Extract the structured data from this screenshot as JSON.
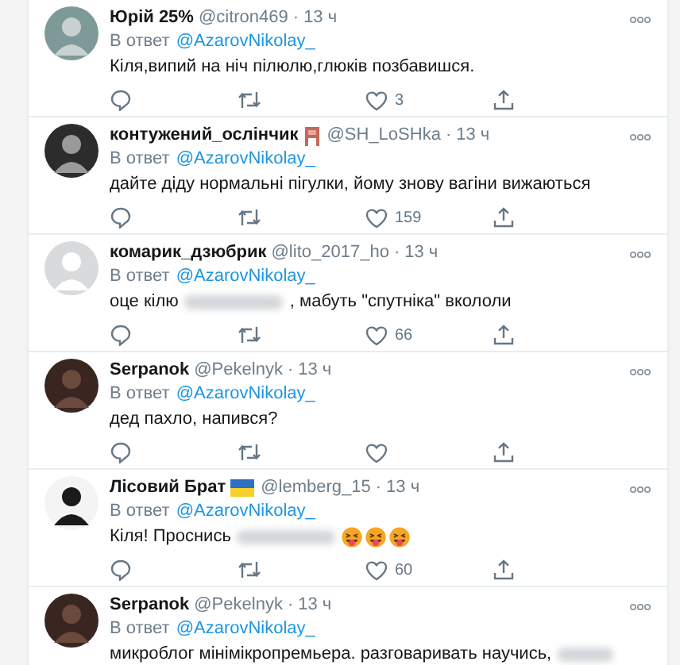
{
  "replies": [
    {
      "name": "Юрій 25%",
      "handle": "@citron469",
      "separator": "·",
      "time": "13 ч",
      "reply_label": "В ответ",
      "reply_to": "@AzarovNikolay_",
      "body": [
        {
          "kind": "text",
          "text": "Кіля,випий на ніч пілюлю,глюків позбавишся."
        }
      ],
      "likes": "3",
      "actions": true
    },
    {
      "name": "контужений_ослінчик",
      "badge": {
        "kind": "chair"
      },
      "handle": "@SH_LoSHka",
      "separator": "·",
      "time": "13 ч",
      "reply_label": "В ответ",
      "reply_to": "@AzarovNikolay_",
      "body": [
        {
          "kind": "text",
          "text": "дайте діду нормальні пігулки, йому знову вагіни вижаються"
        }
      ],
      "likes": "159",
      "actions": true
    },
    {
      "name": "комарик_дзюбрик",
      "handle": "@lito_2017_ho",
      "separator": "·",
      "time": "13 ч",
      "reply_label": "В ответ",
      "reply_to": "@AzarovNikolay_",
      "body": [
        {
          "kind": "text",
          "text": "оце кілю"
        },
        {
          "kind": "blur"
        },
        {
          "kind": "text",
          "text": ", мабуть \"спутніка\" вкололи"
        }
      ],
      "likes": "66",
      "actions": true
    },
    {
      "name": "Serpanok",
      "handle": "@Pekelnyk",
      "separator": "·",
      "time": "13 ч",
      "reply_label": "В ответ",
      "reply_to": "@AzarovNikolay_",
      "body": [
        {
          "kind": "text",
          "text": "дед пахло, напився?"
        }
      ],
      "actions": true
    },
    {
      "name": "Лісовий Брат",
      "badge": {
        "kind": "flag"
      },
      "handle": "@lemberg_15",
      "separator": "·",
      "time": "13 ч",
      "reply_label": "В ответ",
      "reply_to": "@AzarovNikolay_",
      "body": [
        {
          "kind": "text",
          "text": "Кіля! Проснись"
        },
        {
          "kind": "blur"
        },
        {
          "kind": "emoji"
        },
        {
          "kind": "emoji"
        },
        {
          "kind": "emoji"
        }
      ],
      "likes": "60",
      "actions": true
    },
    {
      "name": "Serpanok",
      "handle": "@Pekelnyk",
      "separator": "·",
      "time": "13 ч",
      "reply_label": "В ответ",
      "reply_to": "@AzarovNikolay_",
      "body": [
        {
          "kind": "text",
          "text": "микроблог мінімікропремьера. разговаривать научись,"
        },
        {
          "kind": "blur"
        }
      ],
      "actions": false
    }
  ]
}
